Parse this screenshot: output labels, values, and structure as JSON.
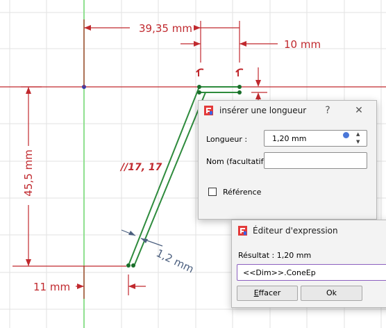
{
  "drawing": {
    "dim_top": "39,35 mm",
    "dim_top_right": "10 mm",
    "dim_left_vertical": "45,5 mm",
    "dim_bottom_left": "11 mm",
    "dim_thickness": "1,2 mm",
    "angle_constraint": "17, 17"
  },
  "length_dialog": {
    "title": "insérer une longueur",
    "help": "?",
    "close": "✕",
    "length_label": "Longueur :",
    "length_value": "1,20 mm",
    "name_label": "Nom (facultatif)",
    "name_value": "",
    "reference_label": "Référence"
  },
  "expr_dialog": {
    "title": "Éditeur d'expression",
    "result_label": "Résultat : 1,20 mm",
    "expression": "<<Dim>>.ConeEp",
    "clear_button": "Effacer",
    "clear_mnemonic": "E",
    "clear_rest": "ffacer",
    "ok_button": "Ok"
  },
  "colors": {
    "dimension": "#c0292e",
    "geometry": "#2e8b3d",
    "accent": "#8b5fbf",
    "axis_green": "#90e090"
  },
  "icons": [
    "freecad-logo-icon",
    "spinner-up-icon",
    "spinner-down-icon",
    "expression-fx-icon",
    "checkbox-icon"
  ]
}
